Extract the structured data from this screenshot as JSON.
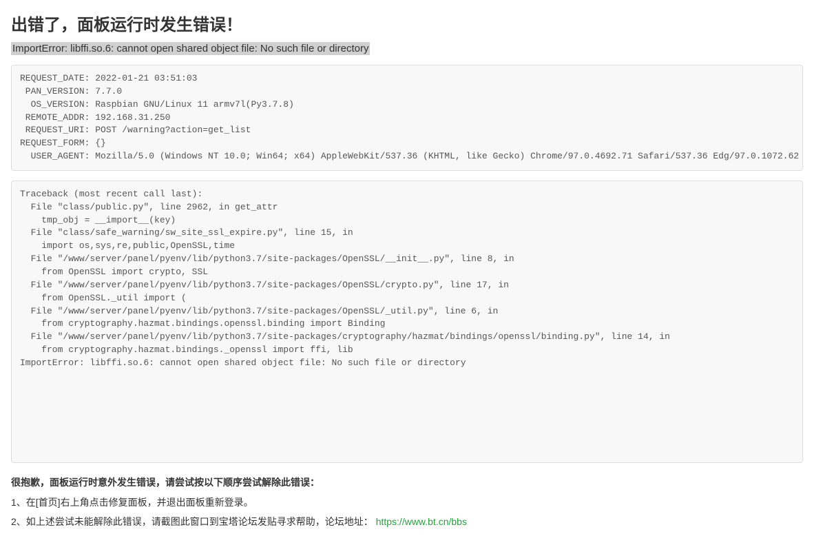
{
  "title": "出错了，面板运行时发生错误！",
  "error_message": "ImportError: libffi.so.6: cannot open shared object file: No such file or directory",
  "request_info": "REQUEST_DATE: 2022-01-21 03:51:03\n PAN_VERSION: 7.7.0\n  OS_VERSION: Raspbian GNU/Linux 11 armv7l(Py3.7.8)\n REMOTE_ADDR: 192.168.31.250\n REQUEST_URI: POST /warning?action=get_list\nREQUEST_FORM: {}\n  USER_AGENT: Mozilla/5.0 (Windows NT 10.0; Win64; x64) AppleWebKit/537.36 (KHTML, like Gecko) Chrome/97.0.4692.71 Safari/537.36 Edg/97.0.1072.62",
  "traceback": "Traceback (most recent call last):\n  File \"class/public.py\", line 2962, in get_attr\n    tmp_obj = __import__(key)\n  File \"class/safe_warning/sw_site_ssl_expire.py\", line 15, in \n    import os,sys,re,public,OpenSSL,time\n  File \"/www/server/panel/pyenv/lib/python3.7/site-packages/OpenSSL/__init__.py\", line 8, in \n    from OpenSSL import crypto, SSL\n  File \"/www/server/panel/pyenv/lib/python3.7/site-packages/OpenSSL/crypto.py\", line 17, in \n    from OpenSSL._util import (\n  File \"/www/server/panel/pyenv/lib/python3.7/site-packages/OpenSSL/_util.py\", line 6, in \n    from cryptography.hazmat.bindings.openssl.binding import Binding\n  File \"/www/server/panel/pyenv/lib/python3.7/site-packages/cryptography/hazmat/bindings/openssl/binding.py\", line 14, in \n    from cryptography.hazmat.bindings._openssl import ffi, lib\nImportError: libffi.so.6: cannot open shared object file: No such file or directory",
  "help": {
    "title": "很抱歉，面板运行时意外发生错误，请尝试按以下顺序尝试解除此错误：",
    "items": [
      "1、在[首页]右上角点击修复面板，并退出面板重新登录。",
      "2、如上述尝试未能解除此错误，请截图此窗口到宝塔论坛发贴寻求帮助，论坛地址："
    ],
    "link_text": "https://www.bt.cn/bbs",
    "link_href": "https://www.bt.cn/bbs"
  }
}
